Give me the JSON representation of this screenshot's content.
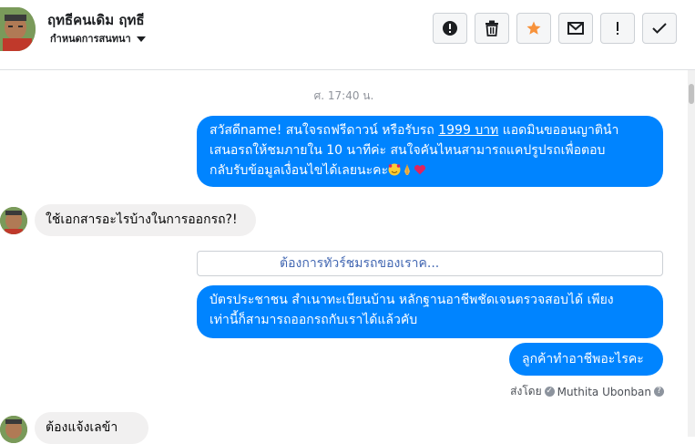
{
  "header": {
    "name": "ฤทธีคนเดิม ฤทธี",
    "sub": "กำหนดการสนทนา"
  },
  "toolbar": {
    "spam_icon": "alert-circle-icon",
    "delete_icon": "trash-icon",
    "star_icon": "star-icon",
    "email_icon": "envelope-icon",
    "mark_icon": "exclamation-icon",
    "done_icon": "check-icon",
    "star_color": "#f7923b"
  },
  "conversation": {
    "timestamp": "ศ. 17:40 น.",
    "messages": [
      {
        "dir": "out",
        "line1_a": "สวัสดีname! สนใจรถฟรีดาวน์ หรือรับรถ ",
        "line1_link": "1999 บาท",
        "line1_b": " แอดมินขออนญาตินำ",
        "line2": "เสนอรถให้ชมภายใน 10 นาทีค่ะ สนใจคันไหนสามารถแคปรูปรถเพื่อตอบ",
        "line3": "กลับรับข้อมูลเงื่อนไขได้เลยนะคะ"
      },
      {
        "dir": "in",
        "text": "ใช้เอกสารอะไรบ้างในการออกรถ?!"
      },
      {
        "dir": "quick",
        "text": "ต้องการทัวร์ชมรถของเราค..."
      },
      {
        "dir": "out",
        "line1": "บัตรประชาชน สำเนาทะเบียนบ้าน หลักฐานอาชีพชัดเจนตรวจสอบได้ เพียง",
        "line2": "เท่านี้ก็สามารถออกรถกับเราได้แล้วคับ"
      },
      {
        "dir": "out",
        "text": "ลูกค้าทำอาชีพอะไรคะ"
      },
      {
        "dir": "in",
        "text": "ต้องแจ้งเลข้า"
      }
    ],
    "sent_by_label": "ส่งโดย",
    "sent_by_name": "Muthita Ubonban",
    "colors": {
      "outgoing": "#0084ff",
      "incoming": "#f1f0f0",
      "link": "#4267b2"
    }
  }
}
